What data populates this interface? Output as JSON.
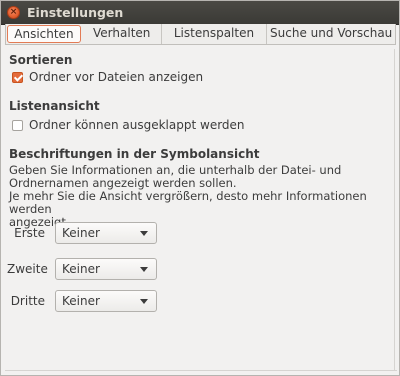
{
  "window": {
    "title": "Einstellungen",
    "close_glyph": "×"
  },
  "tabs": [
    {
      "label": "Ansichten",
      "active": true
    },
    {
      "label": "Verhalten",
      "active": false
    },
    {
      "label": "Listenspalten",
      "active": false
    },
    {
      "label": "Suche und Vorschau",
      "active": false
    }
  ],
  "sorting": {
    "heading": "Sortieren",
    "folders_first_label": "Ordner vor Dateien anzeigen",
    "folders_first_checked": true
  },
  "list_view": {
    "heading": "Listenansicht",
    "expandable_label": "Ordner können ausgeklappt werden",
    "expandable_checked": false
  },
  "icon_captions": {
    "heading": "Beschriftungen in der Symbolansicht",
    "description_1": "Geben Sie Informationen an, die unterhalb der Datei- und",
    "description_2": "Ordnernamen angezeigt werden sollen.",
    "description_3": "Je mehr Sie die Ansicht vergrößern, desto mehr Informationen werden",
    "description_4": "angezeigt.",
    "rows": [
      {
        "label": "Erste",
        "value": "Keiner"
      },
      {
        "label": "Zweite",
        "value": "Keiner"
      },
      {
        "label": "Dritte",
        "value": "Keiner"
      }
    ]
  },
  "colors": {
    "accent": "#e46b3b",
    "titlebar": "#3f3e3a",
    "background": "#f2f1f0"
  }
}
